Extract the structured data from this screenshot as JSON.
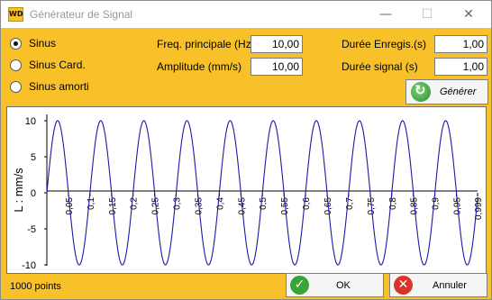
{
  "window": {
    "title": "Générateur de Signal",
    "app_icon_text": "WD",
    "controls": {
      "minimize": "—",
      "maximize": "☐",
      "close": "✕"
    }
  },
  "signal_type": {
    "options": [
      "Sinus",
      "Sinus Card.",
      "Sinus amorti"
    ],
    "selected": "Sinus"
  },
  "fields": {
    "freq_label": "Freq. principale (Hz)",
    "freq_value": "10,00",
    "amplitude_label": "Amplitude (mm/s)",
    "amplitude_value": "10,00",
    "record_label": "Durée Enregis.(s)",
    "record_value": "1,00",
    "signal_label": "Durée signal (s)",
    "signal_value": "1,00"
  },
  "buttons": {
    "generate": "Générer",
    "ok": "OK",
    "cancel": "Annuler"
  },
  "status": "1000 points",
  "colors": {
    "background": "#f8c12a",
    "curve": "#1a1aa8"
  },
  "chart_data": {
    "type": "line",
    "ylabel": "L : mm/s",
    "xlabel": "",
    "ylim": [
      -10,
      10
    ],
    "xlim": [
      0,
      0.999
    ],
    "y_ticks": [
      "10",
      "5",
      "0",
      "-5",
      "-10"
    ],
    "x_ticks": [
      "0,05",
      "0,1",
      "0,15",
      "0,2",
      "0,25",
      "0,3",
      "0,35",
      "0,4",
      "0,45",
      "0,5",
      "0,55",
      "0,6",
      "0,65",
      "0,7",
      "0,75",
      "0,8",
      "0,85",
      "0,9",
      "0,95",
      "0,999"
    ],
    "series": [
      {
        "function": "sine",
        "frequency_hz": 10,
        "amplitude": 10,
        "points": 1000
      }
    ]
  }
}
